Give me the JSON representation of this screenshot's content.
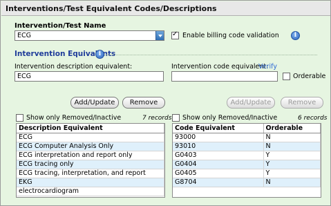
{
  "title": "Interventions/Test Equivalent Codes/Descriptions",
  "intervention_name": {
    "label": "Intervention/Test Name",
    "value": "ECG"
  },
  "billing_validation": {
    "label": "Enable billing code validation",
    "checked": true
  },
  "equivalents": {
    "title": "Intervention Equivalents",
    "description_label": "Intervention description equivalent:",
    "description_value": "ECG",
    "code_label": "Intervention code equivalent:",
    "code_value": "",
    "verify_link": "Verify",
    "orderable_label": "Orderable"
  },
  "buttons": {
    "add_update": "Add/Update",
    "remove": "Remove"
  },
  "left_list": {
    "show_removed_label": "Show only Removed/Inactive",
    "records": "7 records",
    "header": "Description Equivalent",
    "rows": [
      "ECG",
      "ECG Computer Analysis Only",
      "ECG interpretation and report only",
      "ECG tracing only",
      "ECG tracing, interpretation, and report",
      "EKG",
      "electrocardiogram"
    ]
  },
  "right_list": {
    "show_removed_label": "Show only Removed/Inactive",
    "records": "6 records",
    "headers": [
      "Code Equivalent",
      "Orderable"
    ],
    "rows": [
      [
        "93000",
        "N"
      ],
      [
        "93010",
        "N"
      ],
      [
        "G0403",
        "Y"
      ],
      [
        "G0404",
        "Y"
      ],
      [
        "G0405",
        "Y"
      ],
      [
        "G8704",
        "N"
      ]
    ]
  },
  "colors": {
    "panel_bg": "#e6f5e1",
    "section_title": "#1f3c9a",
    "alt_row": "#dff0fb",
    "link": "#2e6ad6"
  }
}
